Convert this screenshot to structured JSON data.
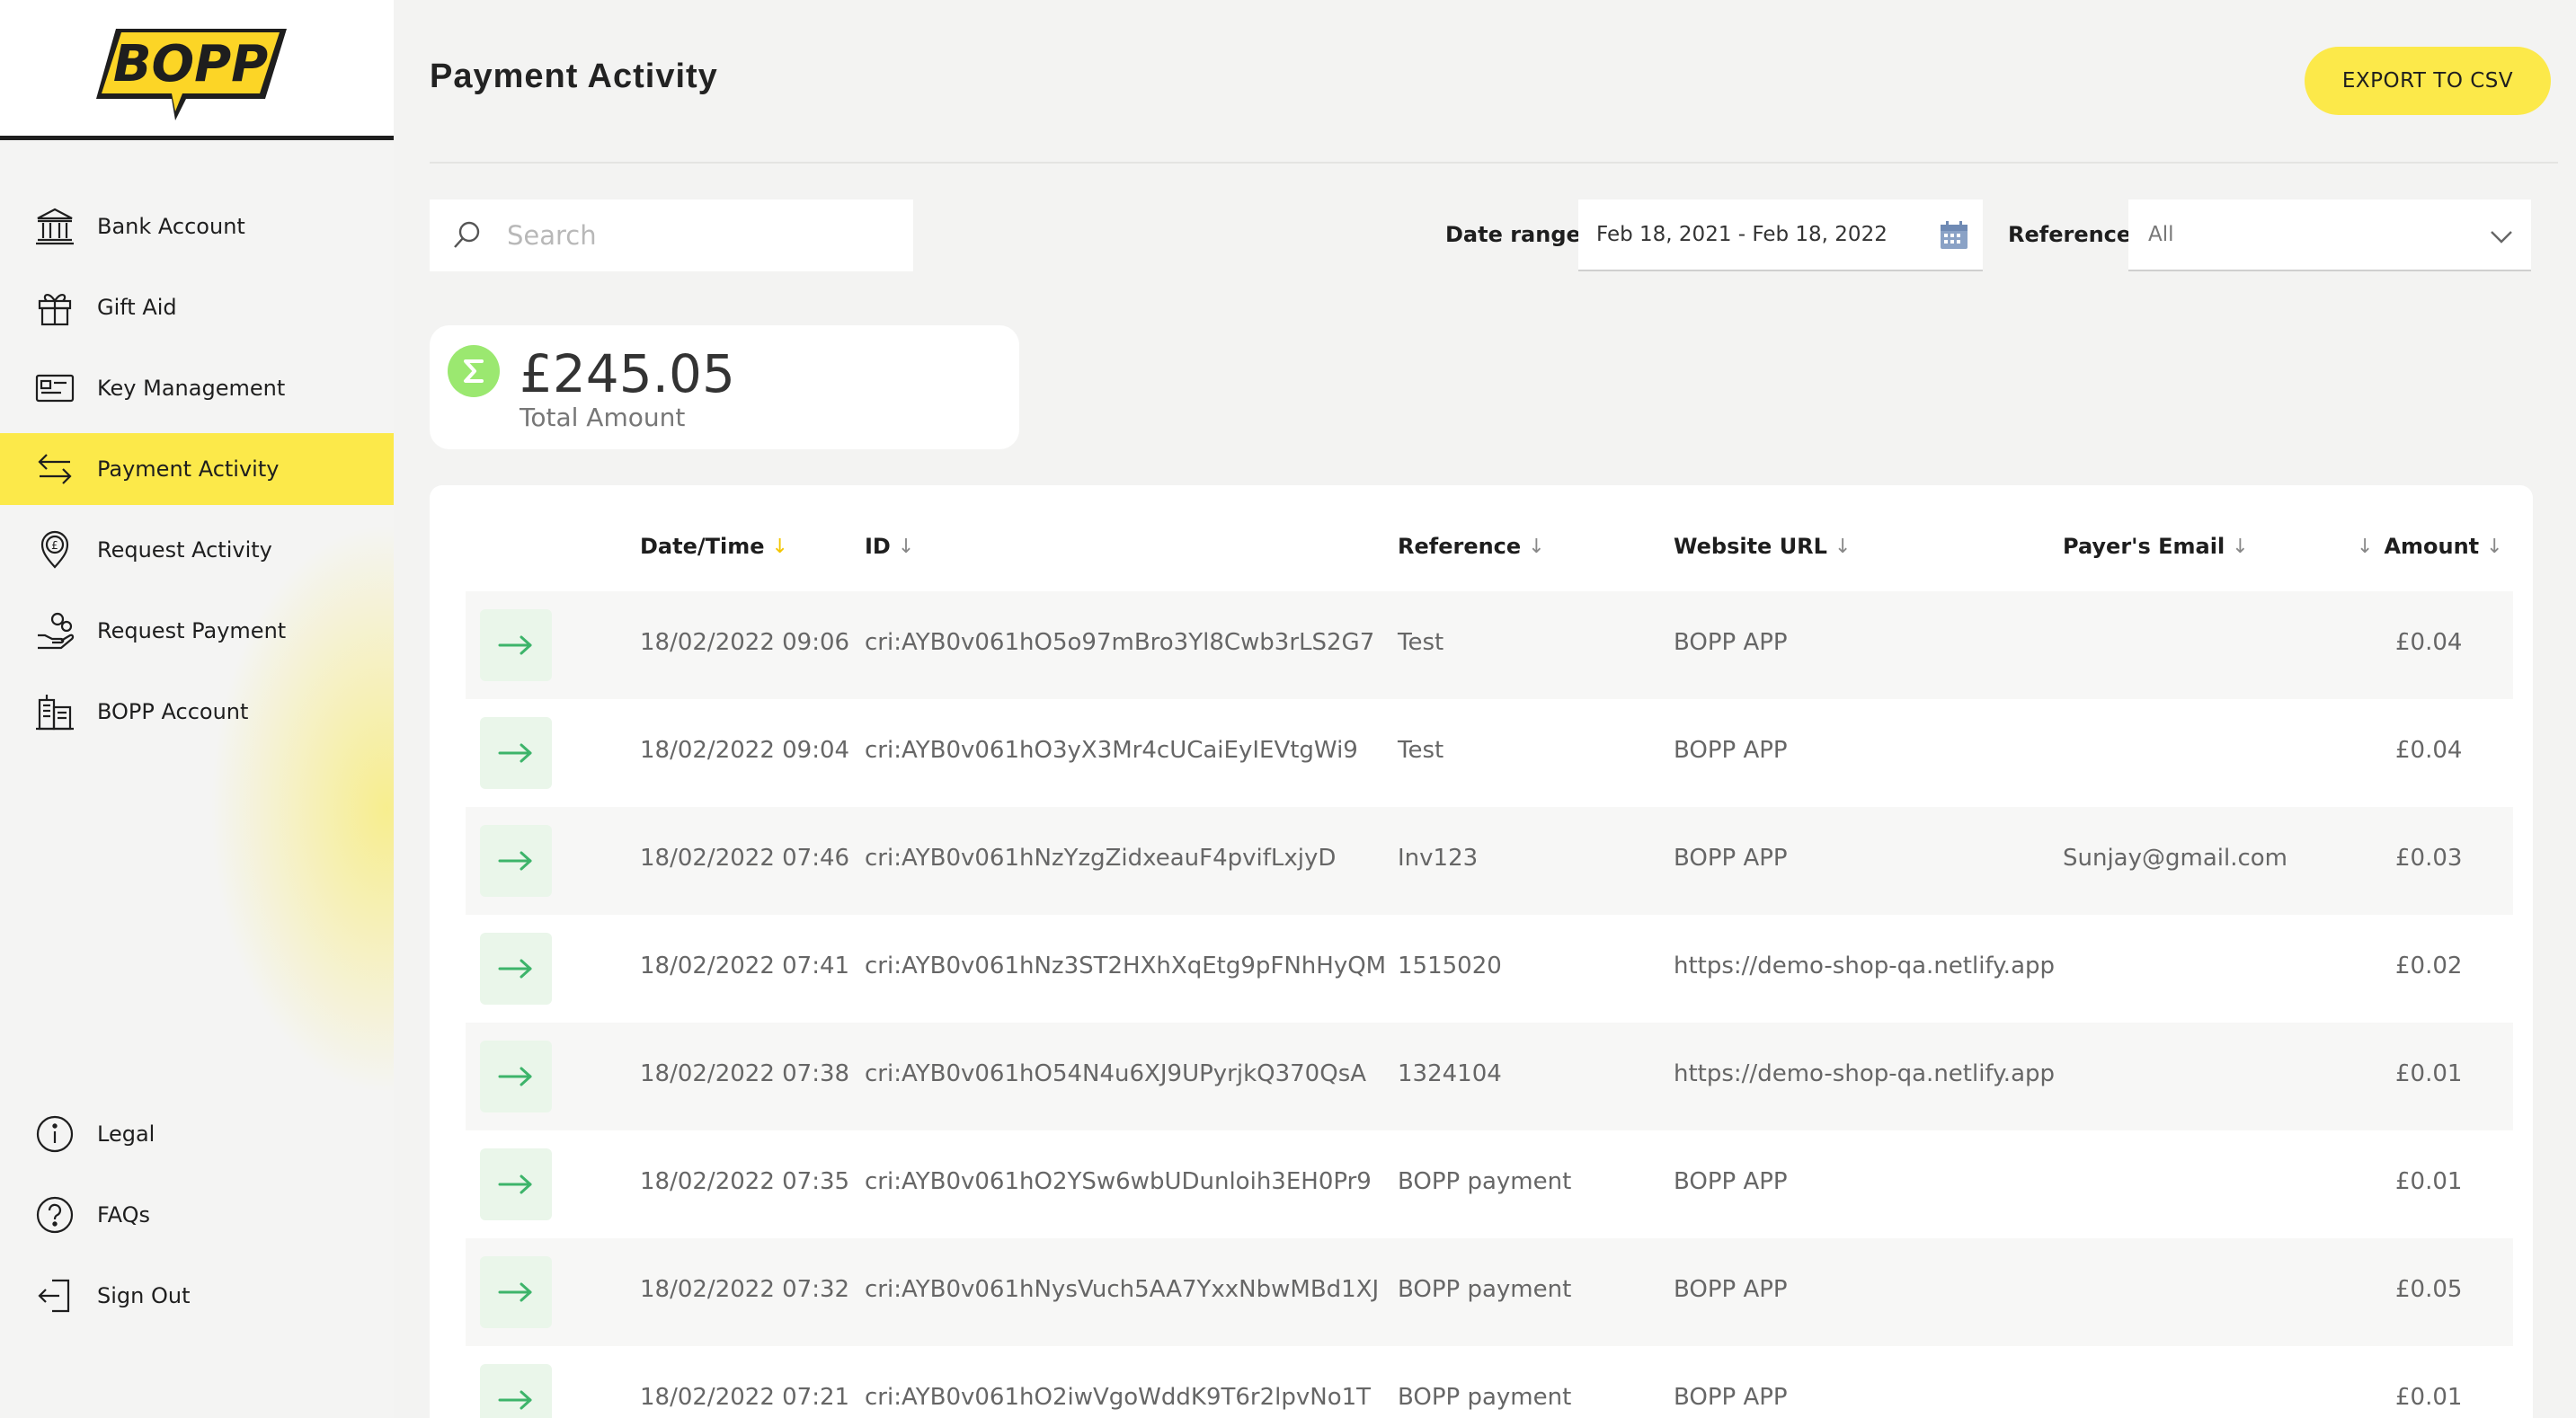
{
  "brand": {
    "logo_text": "BOPP",
    "accent": "#fce94a"
  },
  "sidebar": {
    "items": [
      {
        "label": "Bank Account",
        "icon": "bank-icon"
      },
      {
        "label": "Gift Aid",
        "icon": "gift-icon"
      },
      {
        "label": "Key Management",
        "icon": "key-card-icon"
      },
      {
        "label": "Payment Activity",
        "icon": "transfer-arrows-icon",
        "active": true
      },
      {
        "label": "Request Activity",
        "icon": "pound-location-icon"
      },
      {
        "label": "Request Payment",
        "icon": "hand-coins-icon"
      },
      {
        "label": "BOPP Account",
        "icon": "buildings-icon"
      }
    ],
    "bottom_items": [
      {
        "label": "Legal",
        "icon": "info-icon"
      },
      {
        "label": "FAQs",
        "icon": "question-icon"
      },
      {
        "label": "Sign Out",
        "icon": "sign-out-icon"
      }
    ]
  },
  "header": {
    "title": "Payment Activity",
    "export_label": "EXPORT TO CSV"
  },
  "filters": {
    "search_placeholder": "Search",
    "date_range_label": "Date range",
    "date_range_value": "Feb 18, 2021 - Feb 18, 2022",
    "reference_label": "Reference",
    "reference_value": "All"
  },
  "summary": {
    "total_amount": "£245.05",
    "total_label": "Total Amount"
  },
  "table": {
    "columns": {
      "datetime": "Date/Time",
      "id": "ID",
      "reference": "Reference",
      "website": "Website URL",
      "email": "Payer's Email",
      "amount": "Amount"
    },
    "rows": [
      {
        "datetime": "18/02/2022 09:06",
        "id": "cri:AYB0v061hO5o97mBro3Yl8Cwb3rLS2G7",
        "reference": "Test",
        "website": "BOPP APP",
        "email": "",
        "amount": "£0.04"
      },
      {
        "datetime": "18/02/2022 09:04",
        "id": "cri:AYB0v061hO3yX3Mr4cUCaiEyIEVtgWi9",
        "reference": "Test",
        "website": "BOPP APP",
        "email": "",
        "amount": "£0.04"
      },
      {
        "datetime": "18/02/2022 07:46",
        "id": "cri:AYB0v061hNzYzgZidxeauF4pvifLxjyD",
        "reference": "Inv123",
        "website": "BOPP APP",
        "email": "Sunjay@gmail.com",
        "amount": "£0.03"
      },
      {
        "datetime": "18/02/2022 07:41",
        "id": "cri:AYB0v061hNz3ST2HXhXqEtg9pFNhHyQM",
        "reference": "1515020",
        "website": "https://demo-shop-qa.netlify.app",
        "email": "",
        "amount": "£0.02"
      },
      {
        "datetime": "18/02/2022 07:38",
        "id": "cri:AYB0v061hO54N4u6XJ9UPyrjkQ370QsA",
        "reference": "1324104",
        "website": "https://demo-shop-qa.netlify.app",
        "email": "",
        "amount": "£0.01"
      },
      {
        "datetime": "18/02/2022 07:35",
        "id": "cri:AYB0v061hO2YSw6wbUDunloih3EH0Pr9",
        "reference": "BOPP payment",
        "website": "BOPP APP",
        "email": "",
        "amount": "£0.01"
      },
      {
        "datetime": "18/02/2022 07:32",
        "id": "cri:AYB0v061hNysVuch5AA7YxxNbwMBd1XJ",
        "reference": "BOPP payment",
        "website": "BOPP APP",
        "email": "",
        "amount": "£0.05"
      },
      {
        "datetime": "18/02/2022 07:21",
        "id": "cri:AYB0v061hO2iwVgoWddK9T6r2lpvNo1T",
        "reference": "BOPP payment",
        "website": "BOPP APP",
        "email": "",
        "amount": "£0.01"
      }
    ]
  }
}
